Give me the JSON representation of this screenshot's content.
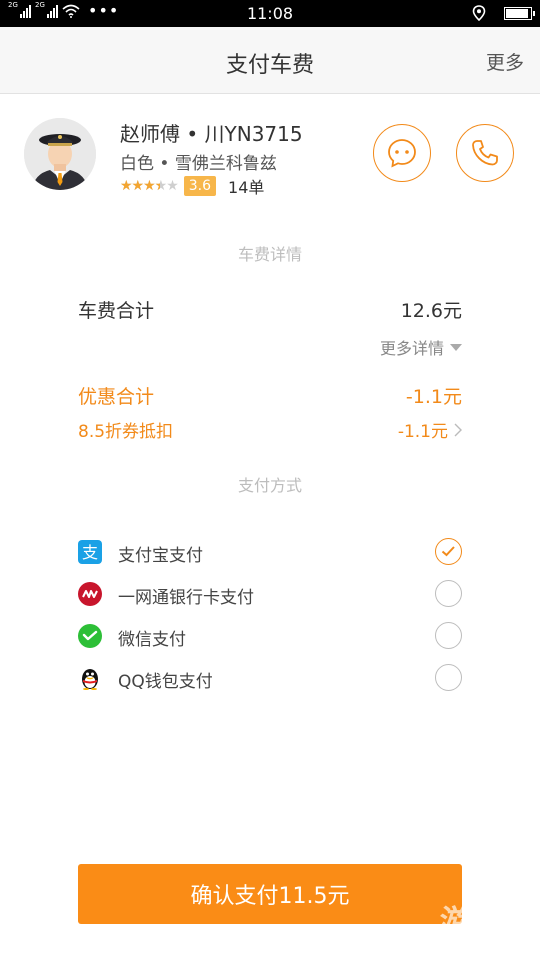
{
  "status_bar": {
    "sim1": "2G",
    "sim2": "2G",
    "time": "11:08"
  },
  "header": {
    "title": "支付车费",
    "more_label": "更多"
  },
  "driver": {
    "name_plate": "赵师傅 • 川YN3715",
    "car_info": "白色 • 雪佛兰科鲁兹",
    "stars": "★★★★★",
    "star_fraction": 0.7,
    "rating": "3.6",
    "orders": "14单"
  },
  "fare": {
    "section_title": "车费详情",
    "total_label": "车费合计",
    "total_value": "12.6元",
    "more_details_label": "更多详情",
    "discount_label": "优惠合计",
    "discount_value": "-1.1元",
    "coupon_label": "8.5折券抵扣",
    "coupon_value": "-1.1元"
  },
  "payment": {
    "section_title": "支付方式",
    "methods": [
      {
        "label": "支付宝支付",
        "icon": "alipay-icon",
        "checked": true
      },
      {
        "label": "一网通银行卡支付",
        "icon": "cmb-icon",
        "checked": false
      },
      {
        "label": "微信支付",
        "icon": "wechat-icon",
        "checked": false
      },
      {
        "label": "QQ钱包支付",
        "icon": "qq-icon",
        "checked": false
      }
    ]
  },
  "confirm_label": "确认支付11.5元",
  "watermark": "游觉",
  "colors": {
    "accent": "#f28a1a",
    "button": "#fa8c16",
    "star": "#f3a531"
  }
}
